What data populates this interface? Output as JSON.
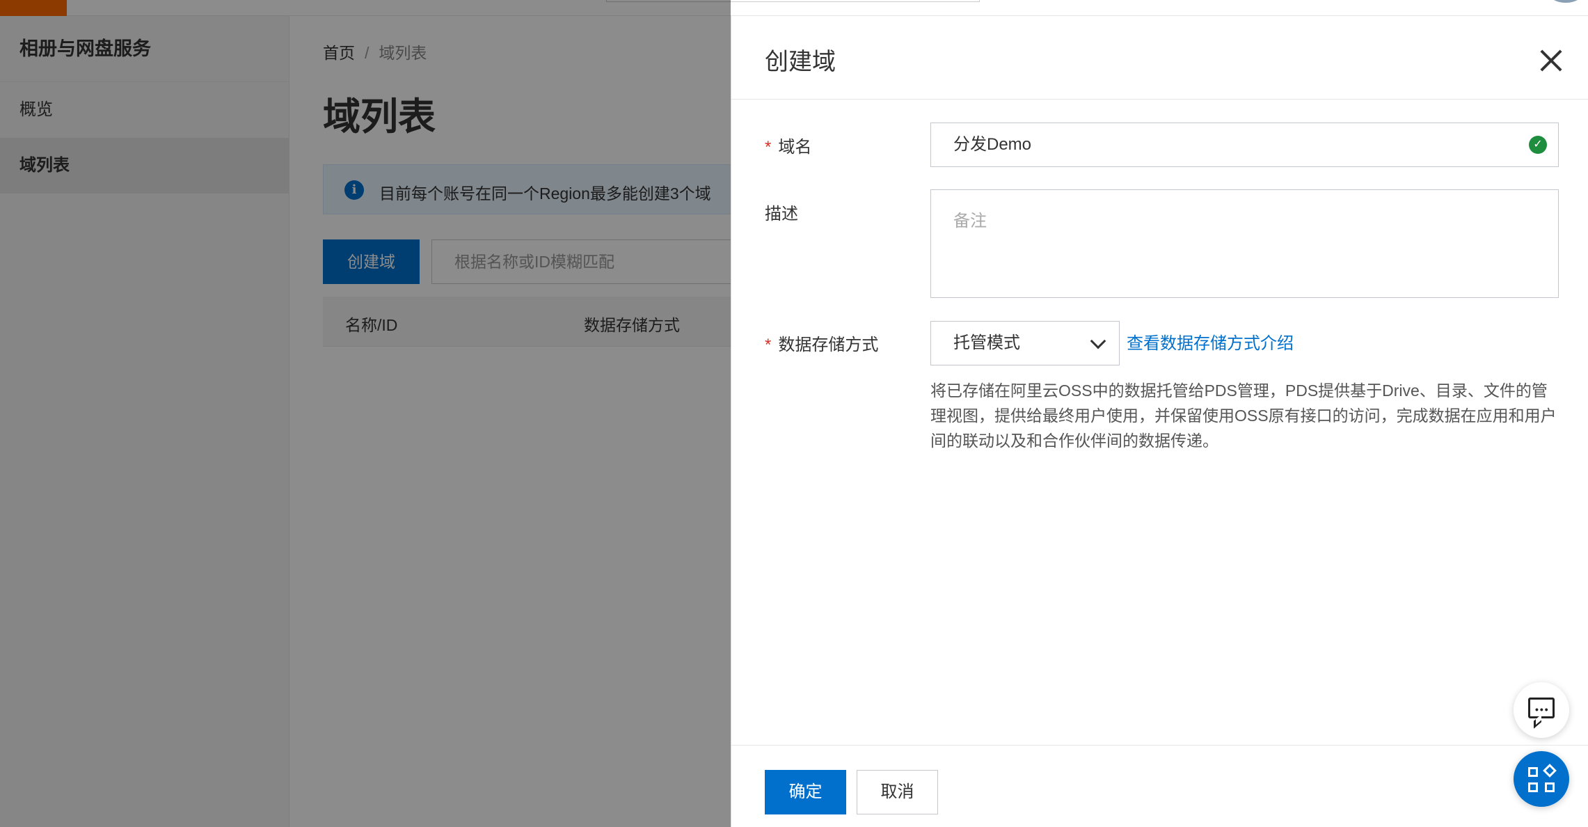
{
  "sidebar": {
    "title": "相册与网盘服务",
    "items": [
      {
        "label": "概览"
      },
      {
        "label": "域列表"
      }
    ]
  },
  "breadcrumb": {
    "home": "首页",
    "separator": "/",
    "current": "域列表"
  },
  "main": {
    "title": "域列表",
    "notice": "目前每个账号在同一个Region最多能创建3个域",
    "create_button": "创建域",
    "search_placeholder": "根据名称或ID模糊匹配",
    "table_headers": [
      "名称/ID",
      "数据存储方式"
    ]
  },
  "drawer": {
    "title": "创建域",
    "fields": {
      "name_label": "域名",
      "name_value": "分发Demo",
      "description_label": "描述",
      "description_placeholder": "备注",
      "storage_label": "数据存储方式",
      "storage_value": "托管模式",
      "storage_link": "查看数据存储方式介绍",
      "storage_help": "将已存储在阿里云OSS中的数据托管给PDS管理，PDS提供基于Drive、目录、文件的管理视图，提供给最终用户使用，并保留使用OSS原有接口的访问，完成数据在应用和用户间的联动以及和合作伙伴间的数据传递。"
    },
    "required_mark": "*",
    "ok_button": "确定",
    "cancel_button": "取消"
  },
  "colors": {
    "brand": "#ff6a00",
    "primary": "#0070cc",
    "success": "#1e8e3e",
    "required": "#d93026"
  },
  "icons": [
    "info-icon",
    "close-icon",
    "check-circle-icon",
    "chevron-down-icon",
    "chevron-left-icon",
    "chat-icon",
    "apps-icon"
  ]
}
